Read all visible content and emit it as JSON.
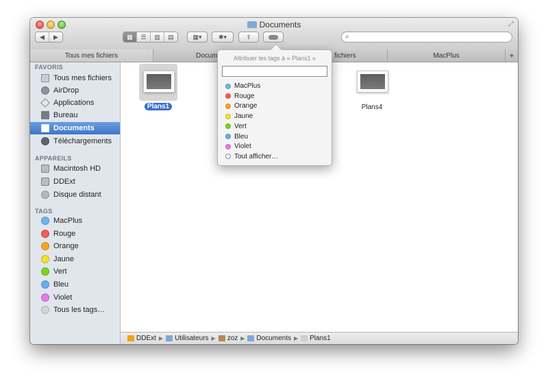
{
  "window": {
    "title": "Documents"
  },
  "tabs": [
    {
      "label": "Tous mes fichiers",
      "active": true
    },
    {
      "label": "Docum"
    },
    {
      "label": "fichiers"
    },
    {
      "label": "MacPlus"
    }
  ],
  "tab_add_label": "+",
  "sidebar": {
    "favorites_label": "FAVORIS",
    "favorites": [
      {
        "label": "Tous mes fichiers"
      },
      {
        "label": "AirDrop"
      },
      {
        "label": "Applications"
      },
      {
        "label": "Bureau"
      },
      {
        "label": "Documents",
        "selected": true
      },
      {
        "label": "Téléchargements"
      }
    ],
    "devices_label": "APPAREILS",
    "devices": [
      {
        "label": "Macintosh HD"
      },
      {
        "label": "DDExt"
      },
      {
        "label": "Disque distant"
      }
    ],
    "tags_label": "TAGS",
    "tags": [
      {
        "label": "MacPlus",
        "color": "#6fb4ee"
      },
      {
        "label": "Rouge",
        "color": "#f25c5c"
      },
      {
        "label": "Orange",
        "color": "#f6a623"
      },
      {
        "label": "Jaune",
        "color": "#f2e12b"
      },
      {
        "label": "Vert",
        "color": "#7ed321"
      },
      {
        "label": "Bleu",
        "color": "#6aaee9"
      },
      {
        "label": "Violet",
        "color": "#e57ae8"
      },
      {
        "label": "Tous les tags…",
        "color": "#d6d6d6"
      }
    ]
  },
  "files": [
    {
      "name": "Plans1",
      "selected": true
    },
    {
      "name": "Plans4"
    }
  ],
  "pathbar": {
    "items": [
      "DDExt",
      "Utilisateurs",
      "zoz",
      "Documents",
      "Plans1"
    ]
  },
  "popover": {
    "title": "Attribuer les tags à « Plans1 »",
    "input_value": "",
    "items": [
      {
        "label": "MacPlus",
        "color": "#6fb4ee"
      },
      {
        "label": "Rouge",
        "color": "#f25c5c"
      },
      {
        "label": "Orange",
        "color": "#f6a623"
      },
      {
        "label": "Jaune",
        "color": "#f2e12b"
      },
      {
        "label": "Vert",
        "color": "#7ed321"
      },
      {
        "label": "Bleu",
        "color": "#6aaee9"
      },
      {
        "label": "Violet",
        "color": "#e57ae8"
      },
      {
        "label": "Tout afficher…",
        "color": "#ffffff"
      }
    ]
  },
  "search": {
    "placeholder": ""
  },
  "icons": {
    "back": "◀",
    "forward": "▶",
    "view_icon": "▦",
    "view_list": "☰",
    "view_column": "▥",
    "view_cover": "▤",
    "arrange": "▦▾",
    "action": "✱▾",
    "share": "⇪",
    "tag": "●",
    "search": "⌕",
    "resize": "⤢"
  }
}
